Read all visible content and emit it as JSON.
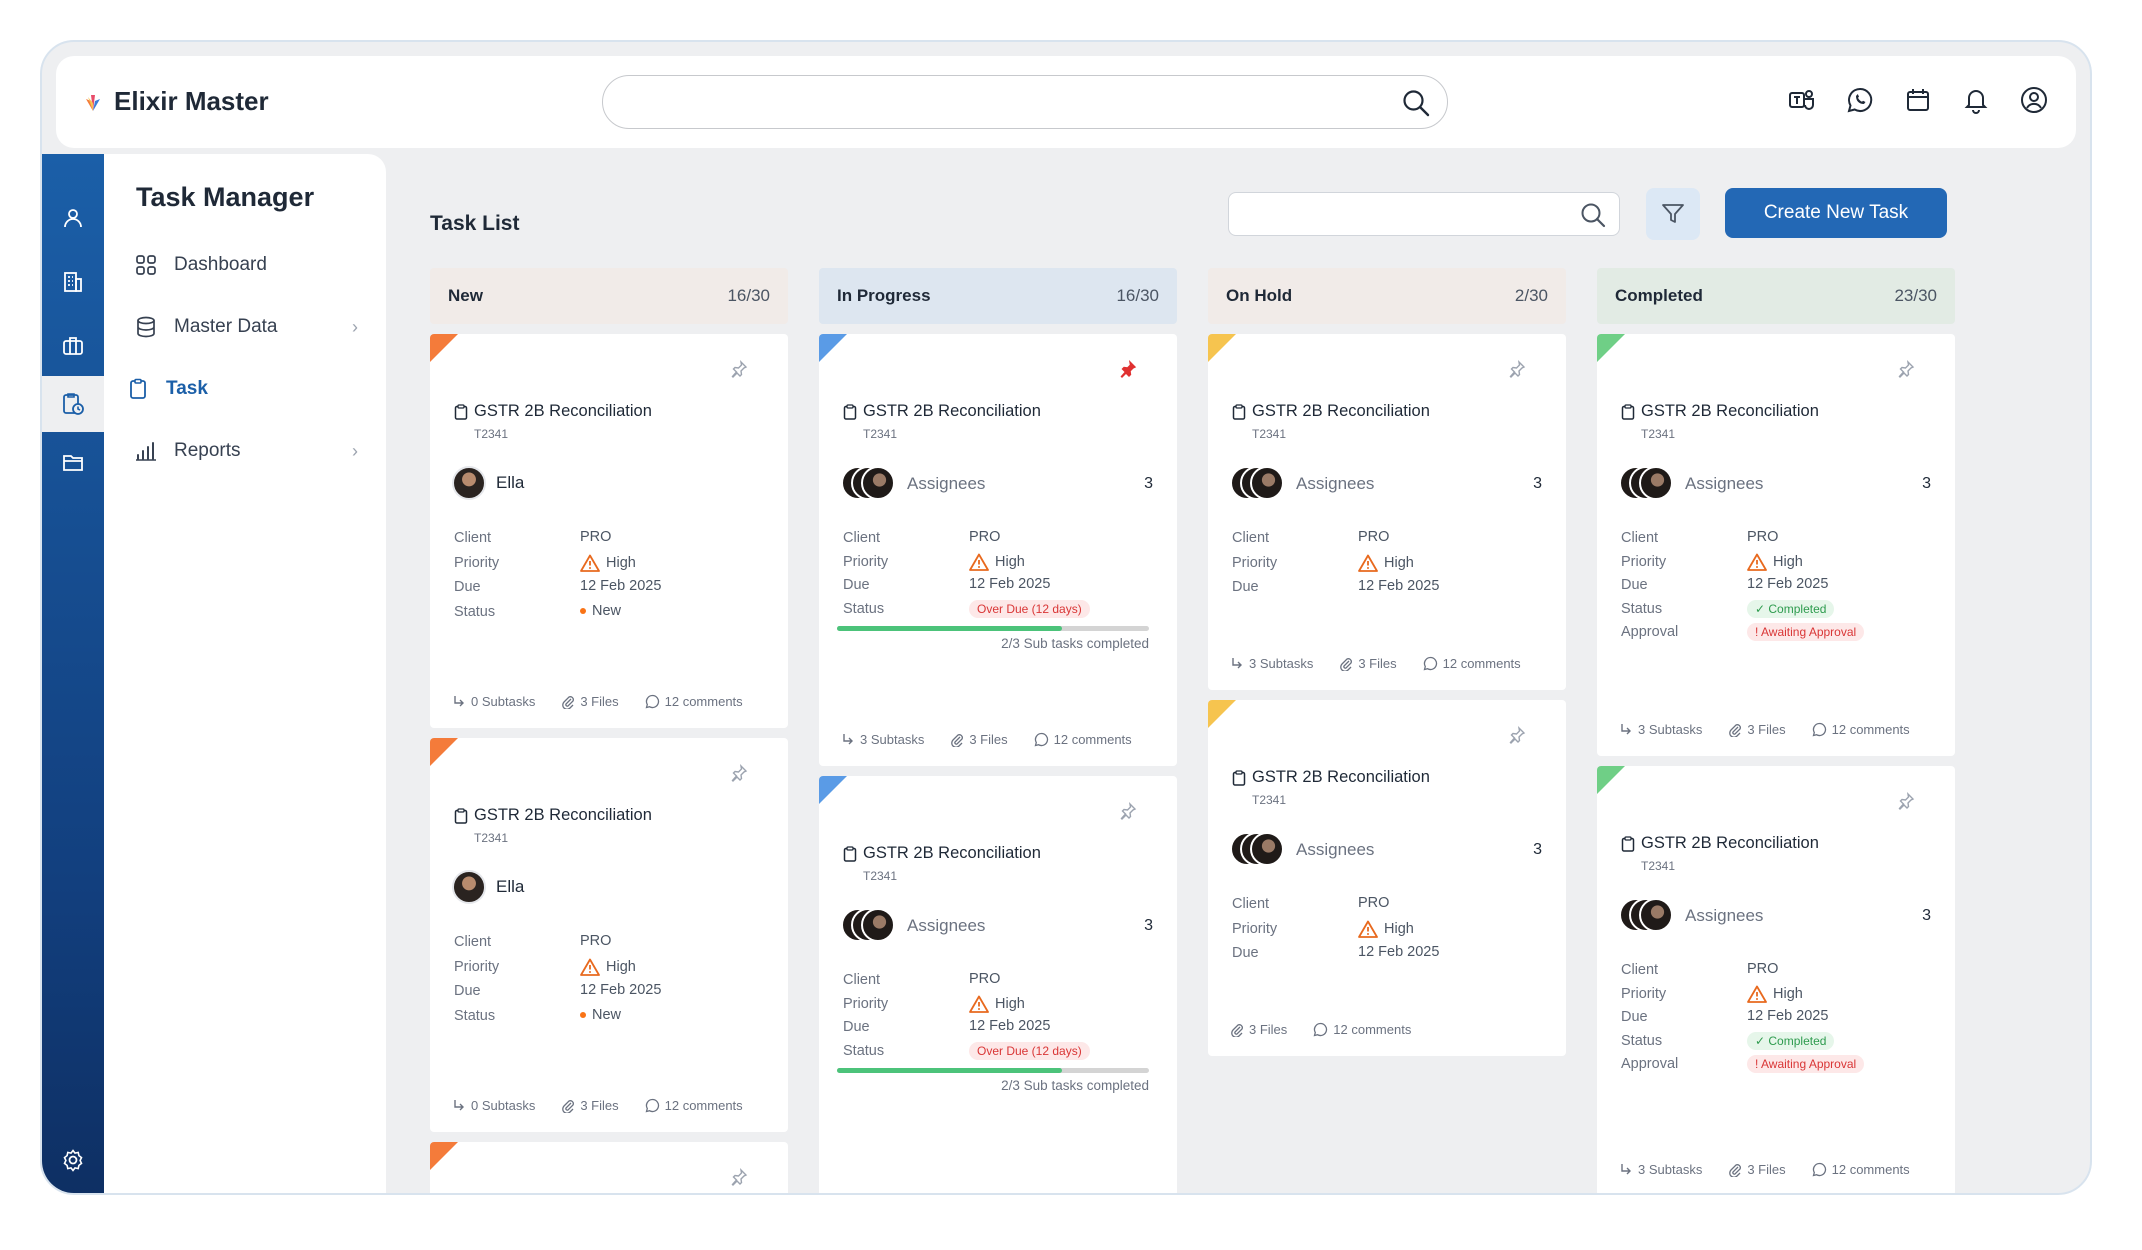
{
  "app": {
    "name": "Elixir Master"
  },
  "header": {
    "search_placeholder": ""
  },
  "sidebar": {
    "title": "Task Manager",
    "items": [
      {
        "label": "Dashboard"
      },
      {
        "label": "Master Data",
        "chevron": "›"
      },
      {
        "label": "Task"
      },
      {
        "label": "Reports",
        "chevron": "›"
      }
    ]
  },
  "main": {
    "title": "Task List",
    "search_placeholder": "",
    "create_label": "Create New Task"
  },
  "columns": [
    {
      "name": "New",
      "count": "16/30",
      "head_color": "#f1ebe8",
      "accent": "#f47b3a",
      "cards": [
        {
          "title": "GSTR 2B Reconciliation",
          "code": "T2341",
          "assignee": "Ella",
          "client_label": "Client",
          "client": "PRO",
          "priority_label": "Priority",
          "priority": "High",
          "due_label": "Due",
          "due": "12 Feb 2025",
          "status_label": "Status",
          "status": "New",
          "subtasks": "0 Subtasks",
          "files": "3 Files",
          "comments": "12 comments"
        },
        {
          "title": "GSTR 2B Reconciliation",
          "code": "T2341",
          "assignee": "Ella",
          "client_label": "Client",
          "client": "PRO",
          "priority_label": "Priority",
          "priority": "High",
          "due_label": "Due",
          "due": "12 Feb 2025",
          "status_label": "Status",
          "status": "New",
          "subtasks": "0 Subtasks",
          "files": "3 Files",
          "comments": "12 comments"
        }
      ]
    },
    {
      "name": "In Progress",
      "count": "16/30",
      "head_color": "#dde6f0",
      "accent": "#5a9be6",
      "cards": [
        {
          "title": "GSTR 2B Reconciliation",
          "code": "T2341",
          "assignee": "Assignees",
          "assignee_count": "3",
          "client_label": "Client",
          "client": "PRO",
          "priority_label": "Priority",
          "priority": "High",
          "due_label": "Due",
          "due": "12 Feb 2025",
          "status_label": "Status",
          "status": "Over Due (12 days)",
          "progress": 0.72,
          "progress_label": "2/3 Sub tasks completed",
          "subtasks": "3 Subtasks",
          "files": "3 Files",
          "comments": "12 comments",
          "pinned": true
        },
        {
          "title": "GSTR 2B Reconciliation",
          "code": "T2341",
          "assignee": "Assignees",
          "assignee_count": "3",
          "client_label": "Client",
          "client": "PRO",
          "priority_label": "Priority",
          "priority": "High",
          "due_label": "Due",
          "due": "12 Feb 2025",
          "status_label": "Status",
          "status": "Over Due (12 days)",
          "progress": 0.72,
          "progress_label": "2/3 Sub tasks completed"
        }
      ]
    },
    {
      "name": "On Hold",
      "count": "2/30",
      "head_color": "#f1ebe8",
      "accent": "#f6c44f",
      "cards": [
        {
          "title": "GSTR 2B Reconciliation",
          "code": "T2341",
          "assignee": "Assignees",
          "assignee_count": "3",
          "client_label": "Client",
          "client": "PRO",
          "priority_label": "Priority",
          "priority": "High",
          "due_label": "Due",
          "due": "12 Feb 2025",
          "subtasks": "3 Subtasks",
          "files": "3 Files",
          "comments": "12 comments"
        },
        {
          "title": "GSTR 2B Reconciliation",
          "code": "T2341",
          "assignee": "Assignees",
          "assignee_count": "3",
          "client_label": "Client",
          "client": "PRO",
          "priority_label": "Priority",
          "priority": "High",
          "due_label": "Due",
          "due": "12 Feb 2025",
          "files": "3 Files",
          "comments": "12 comments"
        }
      ]
    },
    {
      "name": "Completed",
      "count": "23/30",
      "head_color": "#e2ebe4",
      "accent": "#6fcf86",
      "cards": [
        {
          "title": "GSTR 2B Reconciliation",
          "code": "T2341",
          "assignee": "Assignees",
          "assignee_count": "3",
          "client_label": "Client",
          "client": "PRO",
          "priority_label": "Priority",
          "priority": "High",
          "due_label": "Due",
          "due": "12 Feb 2025",
          "status_label": "Status",
          "status": "Completed",
          "approval_label": "Approval",
          "approval": "! Awaiting Approval",
          "subtasks": "3 Subtasks",
          "files": "3 Files",
          "comments": "12 comments"
        },
        {
          "title": "GSTR 2B Reconciliation",
          "code": "T2341",
          "assignee": "Assignees",
          "assignee_count": "3",
          "client_label": "Client",
          "client": "PRO",
          "priority_label": "Priority",
          "priority": "High",
          "due_label": "Due",
          "due": "12 Feb 2025",
          "status_label": "Status",
          "status": "Completed",
          "approval_label": "Approval",
          "approval": "! Awaiting Approval",
          "subtasks": "3 Subtasks",
          "files": "3 Files",
          "comments": "12 comments"
        }
      ]
    }
  ]
}
